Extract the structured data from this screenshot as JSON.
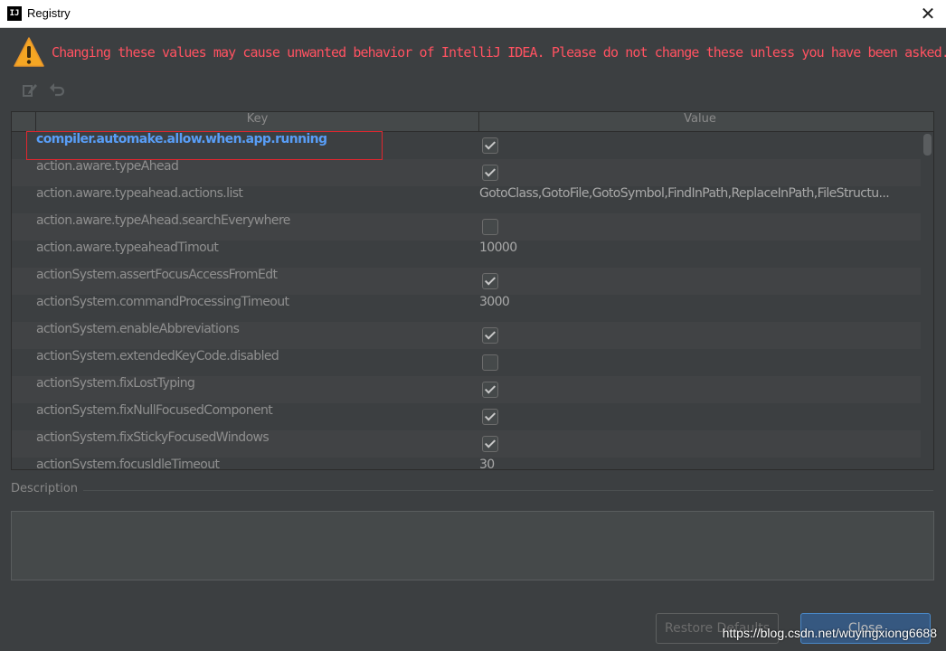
{
  "window": {
    "title": "Registry",
    "app_icon": "IJ"
  },
  "warning": {
    "icon": "warning-triangle-icon",
    "text": "Changing these values may cause unwanted behavior of IntelliJ IDEA. Please do not change these unless you have been asked."
  },
  "toolbar": {
    "edit_icon": "edit-icon",
    "undo_icon": "undo-icon"
  },
  "table": {
    "columns": {
      "key": "Key",
      "value": "Value"
    },
    "rows": [
      {
        "key": "compiler.automake.allow.when.app.running",
        "type": "bool",
        "value": true,
        "highlighted": true
      },
      {
        "key": "action.aware.typeAhead",
        "type": "bool",
        "value": true
      },
      {
        "key": "action.aware.typeahead.actions.list",
        "type": "text",
        "value": "GotoClass,GotoFile,GotoSymbol,FindInPath,ReplaceInPath,FileStructu..."
      },
      {
        "key": "action.aware.typeAhead.searchEverywhere",
        "type": "bool",
        "value": false
      },
      {
        "key": "action.aware.typeaheadTimout",
        "type": "text",
        "value": "10000"
      },
      {
        "key": "actionSystem.assertFocusAccessFromEdt",
        "type": "bool",
        "value": true
      },
      {
        "key": "actionSystem.commandProcessingTimeout",
        "type": "text",
        "value": "3000"
      },
      {
        "key": "actionSystem.enableAbbreviations",
        "type": "bool",
        "value": true
      },
      {
        "key": "actionSystem.extendedKeyCode.disabled",
        "type": "bool",
        "value": false
      },
      {
        "key": "actionSystem.fixLostTyping",
        "type": "bool",
        "value": true
      },
      {
        "key": "actionSystem.fixNullFocusedComponent",
        "type": "bool",
        "value": true
      },
      {
        "key": "actionSystem.fixStickyFocusedWindows",
        "type": "bool",
        "value": true
      },
      {
        "key": "actionSystem.focusIdleTimeout",
        "type": "text",
        "value": "30"
      }
    ]
  },
  "description": {
    "label": "Description",
    "value": ""
  },
  "buttons": {
    "restore": "Restore Defaults",
    "close": "Close"
  },
  "watermark": "https://blog.csdn.net/wuyingxiong6688",
  "colors": {
    "background": "#3c3f41",
    "warning_text": "#ff5261",
    "highlight_key": "#589df6",
    "highlight_box": "#e0262e",
    "primary_button": "#365880"
  }
}
